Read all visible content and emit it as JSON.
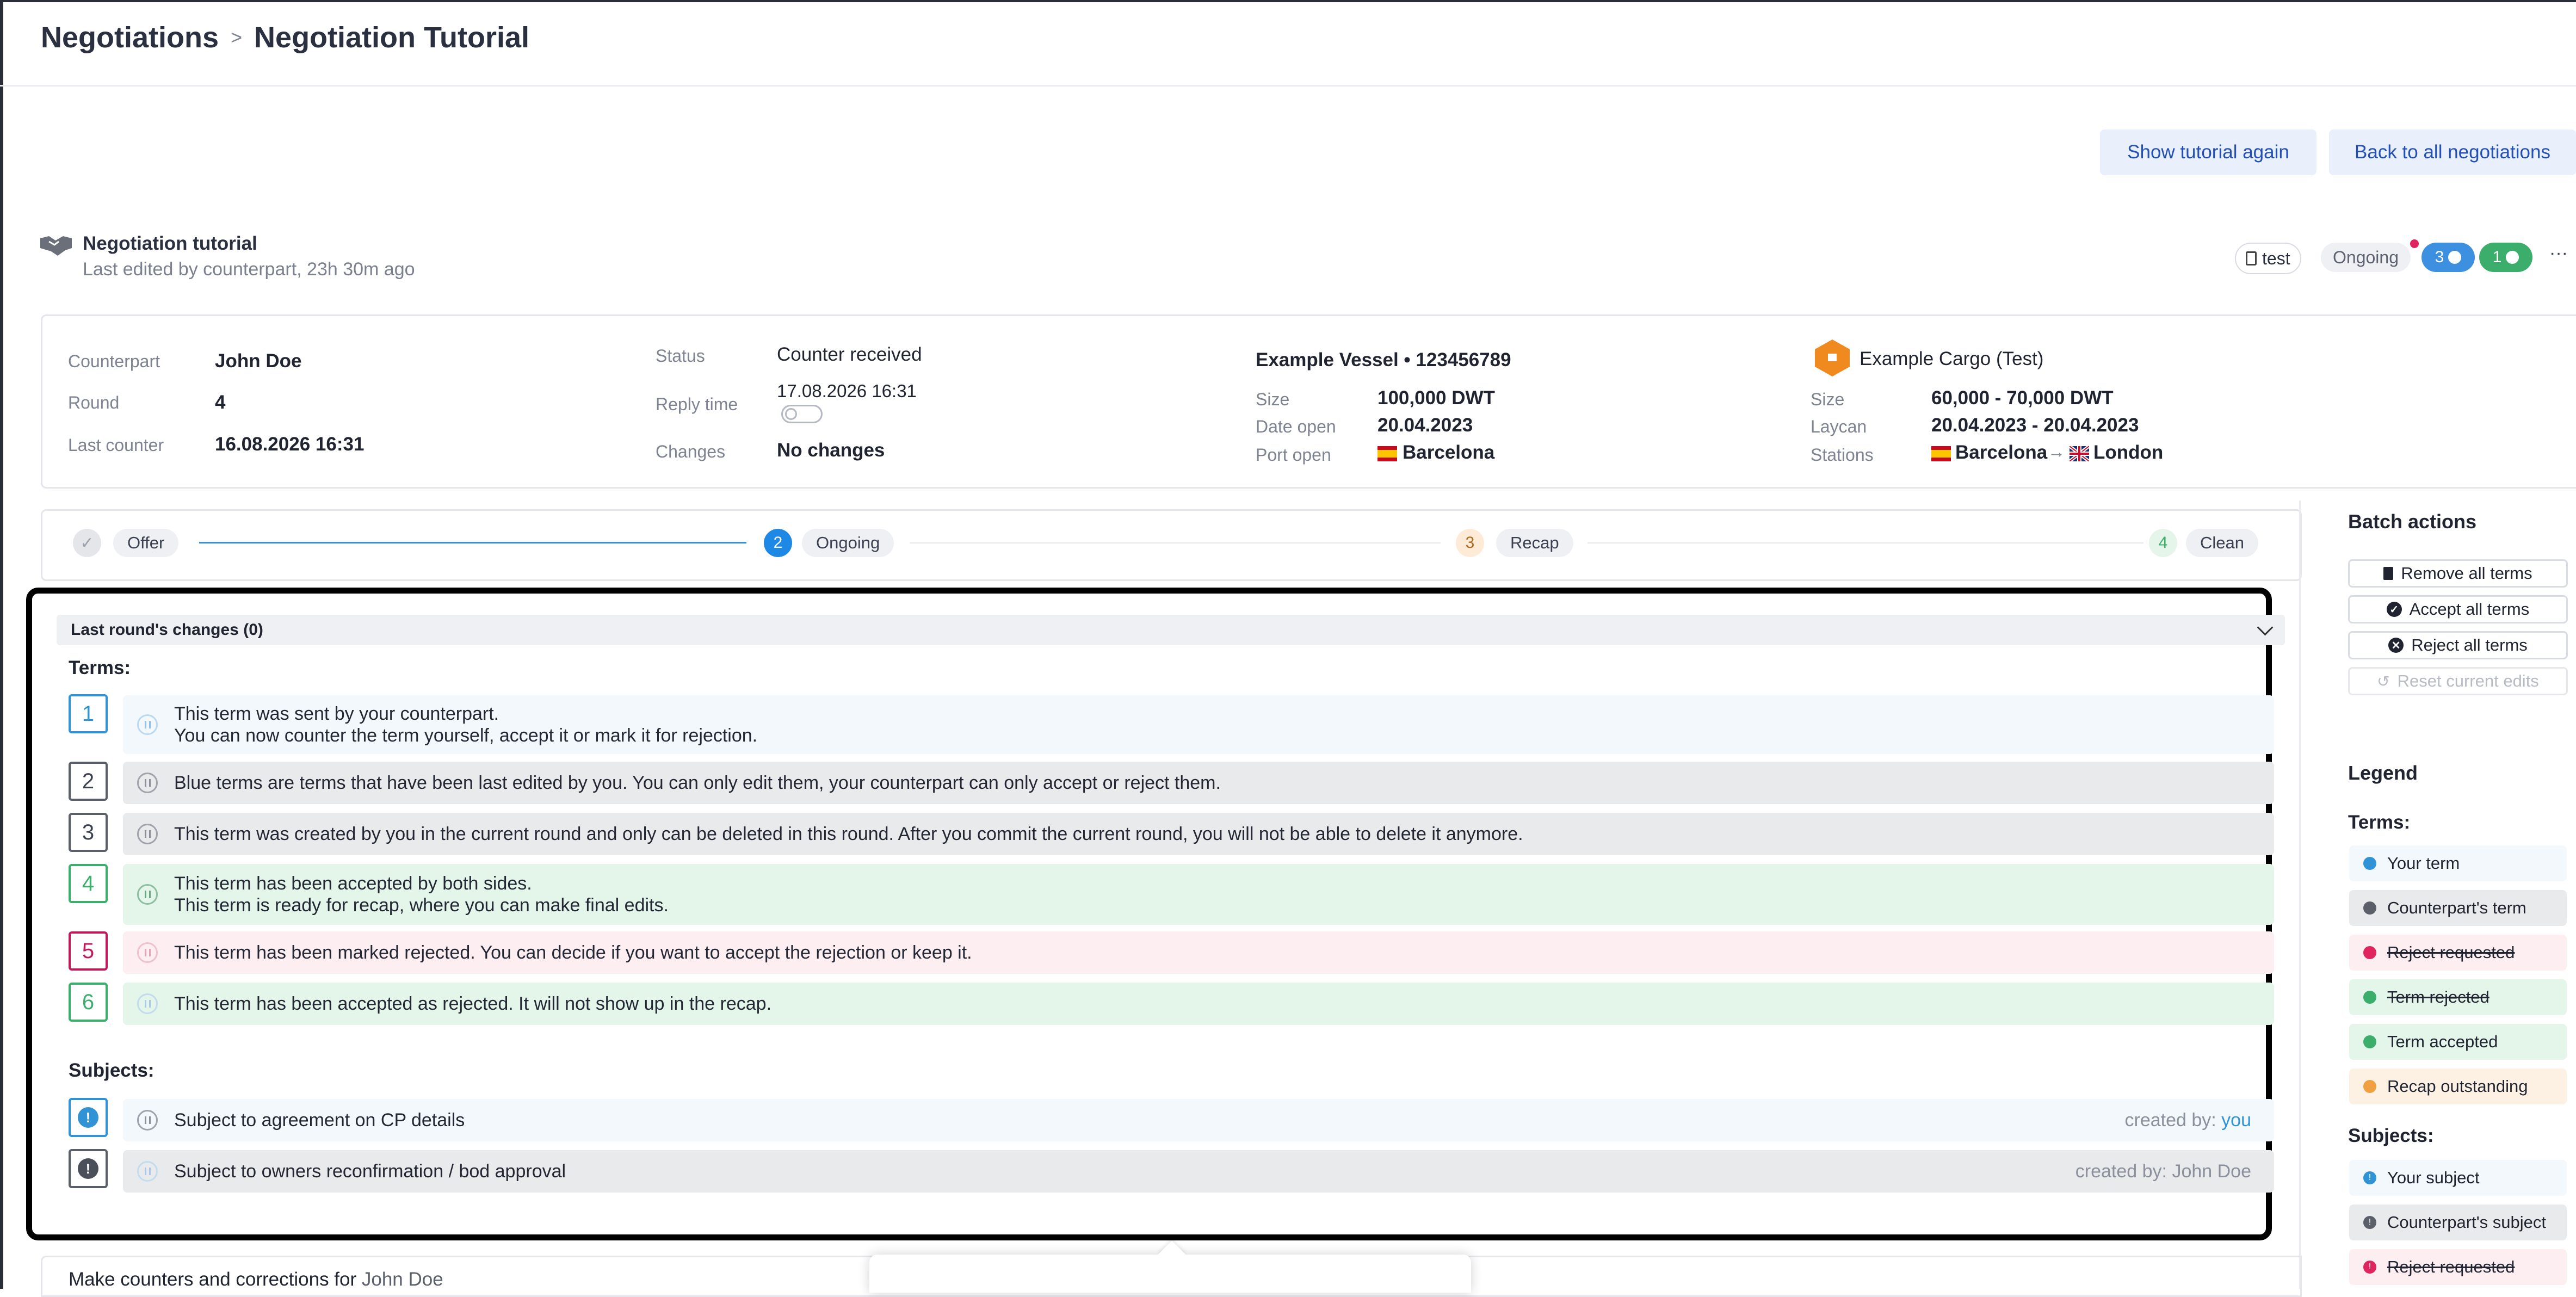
{
  "breadcrumb": {
    "root": "Negotiations",
    "separator": ">",
    "current": "Negotiation Tutorial"
  },
  "top_buttons": {
    "show_tutorial": "Show tutorial again",
    "back": "Back to all negotiations"
  },
  "negotiation": {
    "title": "Negotiation tutorial",
    "subtitle": "Last edited by counterpart, 23h 30m ago",
    "doc_tag": "test",
    "status_pill": "Ongoing",
    "count_blue": "3",
    "count_green": "1",
    "more": "···"
  },
  "details": {
    "counterpart_label": "Counterpart",
    "counterpart": "John Doe",
    "round_label": "Round",
    "round": "4",
    "last_counter_label": "Last counter",
    "last_counter": "16.08.2026 16:31",
    "status_label": "Status",
    "status": "Counter received",
    "reply_time_label": "Reply time",
    "reply_time": "17.08.2026 16:31",
    "changes_label": "Changes",
    "changes": "No changes",
    "vessel_title": "Example Vessel • 123456789",
    "vessel_size_label": "Size",
    "vessel_size": "100,000 DWT",
    "date_open_label": "Date open",
    "date_open": "20.04.2023",
    "port_open_label": "Port open",
    "port_open": "Barcelona",
    "cargo_title": "Example Cargo (Test)",
    "cargo_size_label": "Size",
    "cargo_size": "60,000 - 70,000 DWT",
    "laycan_label": "Laycan",
    "laycan": "20.04.2023 - 20.04.2023",
    "stations_label": "Stations",
    "station_from": "Barcelona",
    "station_arrow": "→",
    "station_to": "London"
  },
  "steps": [
    {
      "num": "✓",
      "label": "Offer"
    },
    {
      "num": "2",
      "label": "Ongoing"
    },
    {
      "num": "3",
      "label": "Recap"
    },
    {
      "num": "4",
      "label": "Clean"
    }
  ],
  "changes_section": {
    "title": "Last round's changes (0)",
    "terms_title": "Terms:",
    "terms": [
      {
        "num": "1",
        "line1": "This term was sent by your counterpart.",
        "line2": "You can now counter the term yourself, accept it or mark it for rejection."
      },
      {
        "num": "2",
        "line1": "Blue terms are terms that have been last edited by you. You can only edit them, your counterpart can only accept or reject them."
      },
      {
        "num": "3",
        "line1": "This term was created by you in the current round and only can be deleted in this round. After you commit the current round, you will not be able to delete it anymore."
      },
      {
        "num": "4",
        "line1": "This term has been accepted by both sides.",
        "line2": "This term is ready for recap, where you can make final edits."
      },
      {
        "num": "5",
        "line1": "This term has been marked rejected. You can decide if you want to accept the rejection or keep it."
      },
      {
        "num": "6",
        "line1": "This term has been accepted as rejected. It will not show up in the recap."
      }
    ],
    "subjects_title": "Subjects:",
    "subjects": [
      {
        "text": "Subject to agreement on CP details",
        "created_prefix": "created by:",
        "created_by": "you"
      },
      {
        "text": "Subject to owners reconfirmation / bod approval",
        "created_prefix": "created by:",
        "created_by": "John Doe"
      }
    ]
  },
  "bottom": {
    "label": "Make counters and corrections for",
    "name": "John Doe"
  },
  "batch": {
    "title": "Batch actions",
    "remove": "Remove all terms",
    "accept": "Accept all terms",
    "reject": "Reject all terms",
    "reset": "Reset current edits"
  },
  "legend": {
    "title": "Legend",
    "terms_title": "Terms:",
    "terms": [
      "Your term",
      "Counterpart's term",
      "Reject requested",
      "Term rejected",
      "Term accepted",
      "Recap outstanding"
    ],
    "subjects_title": "Subjects:",
    "subjects": [
      "Your subject",
      "Counterpart's subject",
      "Reject requested"
    ]
  },
  "colors": {
    "blue": "#2f93d6",
    "gray": "#5a5f6a",
    "green": "#3aae6a",
    "red": "#d6336c",
    "orange": "#f0a040",
    "cargo_orange": "#f08a1f",
    "highlight_border": "#000000"
  }
}
